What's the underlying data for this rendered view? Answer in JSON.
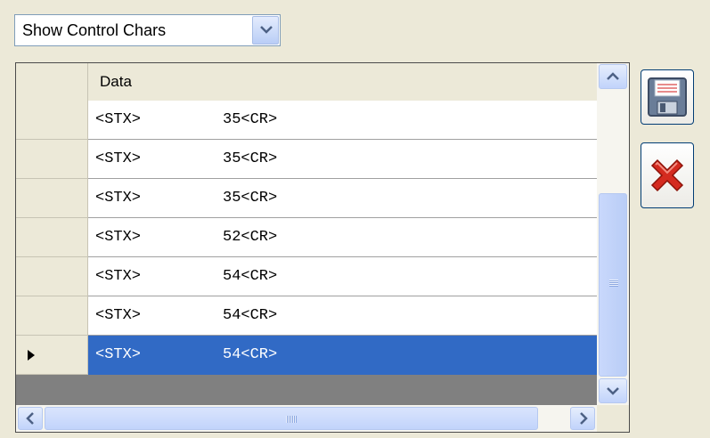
{
  "filter": {
    "selected": "Show Control Chars",
    "dropdown_icon": "chevron-down-icon"
  },
  "grid": {
    "columns": [
      "Data"
    ],
    "rows": [
      {
        "c1": "<STX>",
        "c2": "35<CR>",
        "selected": false
      },
      {
        "c1": "<STX>",
        "c2": "35<CR>",
        "selected": false
      },
      {
        "c1": "<STX>",
        "c2": "35<CR>",
        "selected": false
      },
      {
        "c1": "<STX>",
        "c2": "52<CR>",
        "selected": false
      },
      {
        "c1": "<STX>",
        "c2": "54<CR>",
        "selected": false
      },
      {
        "c1": "<STX>",
        "c2": "54<CR>",
        "selected": false
      },
      {
        "c1": "<STX>",
        "c2": "54<CR>",
        "selected": true
      }
    ]
  },
  "actions": {
    "save_icon": "floppy-disk-icon",
    "delete_icon": "red-x-icon"
  },
  "colors": {
    "selection": "#316ac5",
    "window_bg": "#ece9d8",
    "border": "#7f9db9"
  }
}
